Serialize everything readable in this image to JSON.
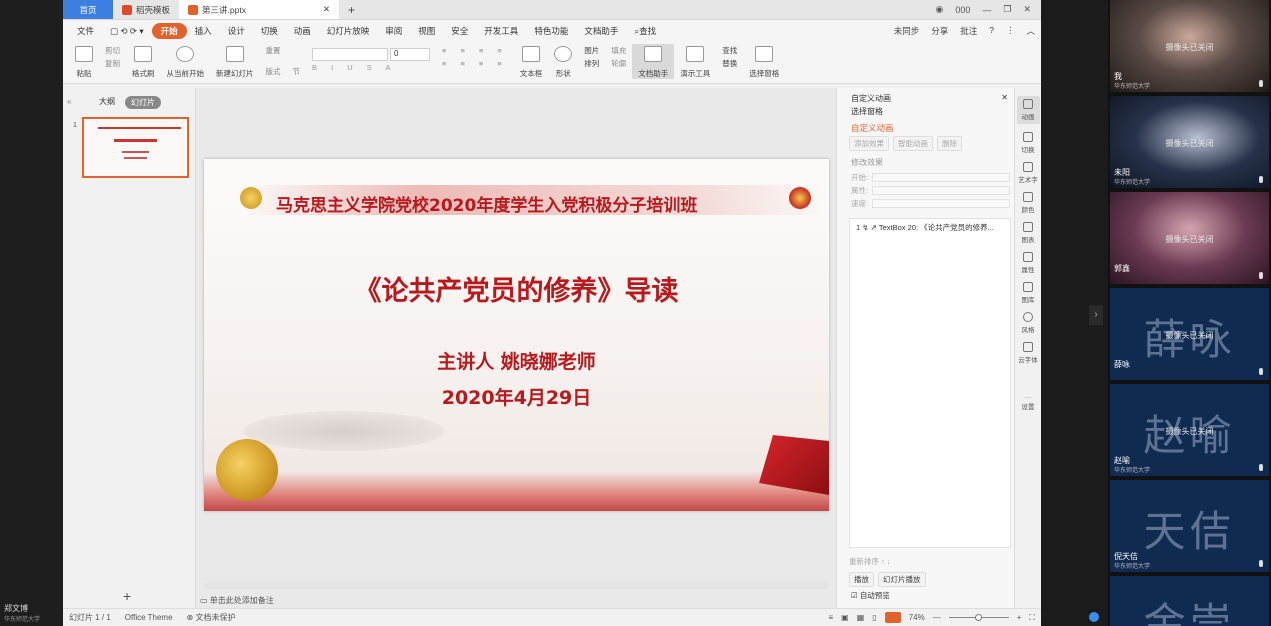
{
  "left_user": {
    "name": "郑文博",
    "org": "华东师范大学"
  },
  "tabs": [
    {
      "label": "首页"
    },
    {
      "label": "稻壳模板"
    },
    {
      "label": "第三讲.pptx"
    }
  ],
  "menu": [
    "文件",
    "开始",
    "插入",
    "设计",
    "切换",
    "动画",
    "幻灯片放映",
    "审阅",
    "视图",
    "安全",
    "开发工具",
    "特色功能",
    "文档助手",
    "查找"
  ],
  "menu_right": [
    "未同步",
    "分享",
    "批注"
  ],
  "user_count": "000",
  "ribbon": {
    "paste": "粘贴",
    "cut": "剪切",
    "copy": "复制",
    "format_painter": "格式刷",
    "from_current": "从当前开始",
    "new_slide": "新建幻灯片",
    "layout": "版式",
    "section": "节",
    "reset": "重置",
    "font_size": "0",
    "textbox": "文本框",
    "shape": "形状",
    "picture": "图片",
    "arrange": "排列",
    "fill": "填充",
    "outline": "轮廓",
    "doc_helper": "文档助手",
    "presentation_tools": "演示工具",
    "find": "查找",
    "replace": "替换",
    "select_pane": "选择窗格"
  },
  "sidebar": {
    "tab_outline": "大纲",
    "tab_slides": "幻灯片",
    "slide_num": "1"
  },
  "slide": {
    "header": "马克思主义学院党校2020年度学生入党积极分子培训班",
    "title": "《论共产党员的修养》导读",
    "speaker": "主讲人 姚晓娜老师",
    "date": "2020年4月29日"
  },
  "notes_placeholder": "单击此处添加备注",
  "anim_panel": {
    "title": "自定义动画",
    "select_pane": "选择窗格",
    "section": "自定义动画",
    "add_effect": "添加效果",
    "smart_anim": "智能动画",
    "delete": "删除",
    "modify": "修改效果",
    "start": "开始:",
    "property": "属性:",
    "speed": "速度:",
    "list_item": "1 ↯ ↗ TextBox 20: 《论共产党员的修养...",
    "reorder": "重新排序",
    "play": "播放",
    "slideshow": "幻灯片播放",
    "autopreview": "自动预览"
  },
  "icon_column": [
    "动画",
    "切换",
    "艺术字",
    "颜色",
    "图表",
    "属性",
    "图库",
    "风格",
    "云字体",
    "设置"
  ],
  "status": {
    "slide_count": "幻灯片 1 / 1",
    "theme": "Office Theme",
    "protect": "文档未保护",
    "zoom": "74%"
  },
  "participants": [
    {
      "name": "我",
      "org": "华东师范大学",
      "cam": "摄像头已关闭",
      "big": ""
    },
    {
      "name": "未阳",
      "org": "华东师范大学",
      "cam": "摄像头已关闭",
      "big": ""
    },
    {
      "name": "郭鑫",
      "org": "",
      "cam": "摄像头已关闭",
      "big": ""
    },
    {
      "name": "薛咏",
      "org": "",
      "cam": "摄像头已关闭",
      "big": "薛咏"
    },
    {
      "name": "赵喻",
      "org": "华东师范大学",
      "cam": "摄像头已关闭",
      "big": "赵喻"
    },
    {
      "name": "倪天佶",
      "org": "华东师范大学",
      "cam": "",
      "big": "天佶"
    },
    {
      "name": "",
      "org": "",
      "cam": "",
      "big": "金崇"
    }
  ],
  "colors": {
    "accent": "#e2622c",
    "slide_red": "#b8191c",
    "tab_blue": "#3c7fe0"
  }
}
